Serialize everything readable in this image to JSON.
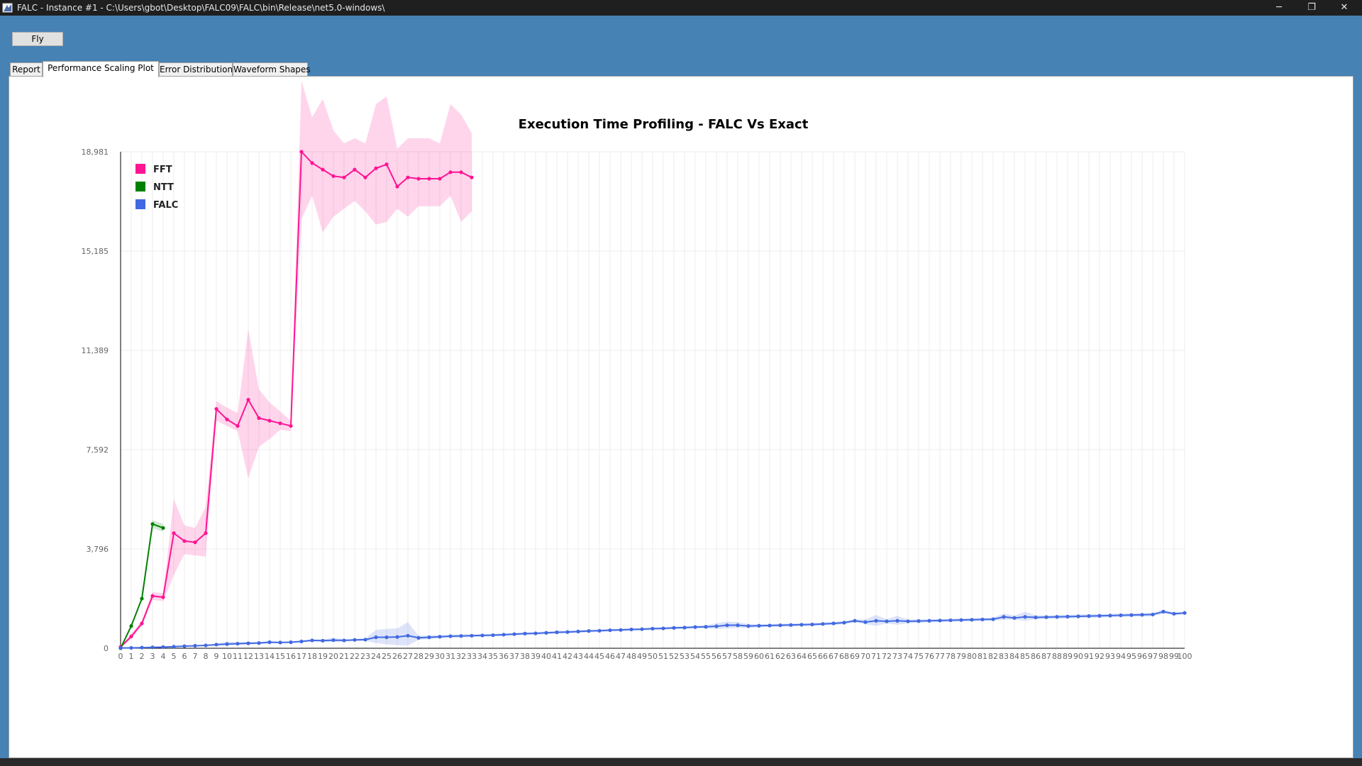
{
  "window": {
    "title": "FALC - Instance #1 - C:\\Users\\gbot\\Desktop\\FALC09\\FALC\\bin\\Release\\net5.0-windows\\",
    "minimize_glyph": "─",
    "maximize_glyph": "❐",
    "close_glyph": "✕"
  },
  "toolbar": {
    "fly_label": "Fly"
  },
  "tabs": [
    {
      "label": "Report",
      "active": false
    },
    {
      "label": "Performance Scaling Plot",
      "active": true
    },
    {
      "label": "Error Distributions",
      "active": false
    },
    {
      "label": "Waveform Shapes",
      "active": false
    }
  ],
  "colors": {
    "fft": "#ff1493",
    "ntt": "#008000",
    "falc": "#4169e1",
    "grid": "#ececec",
    "axis": "#000000",
    "tick_text": "#666666"
  },
  "chart_data": {
    "type": "line",
    "title": "Execution Time Profiling - FALC Vs Exact",
    "xlabel": "",
    "ylabel": "",
    "xlim": [
      0,
      100
    ],
    "ylim": [
      0,
      18981
    ],
    "yticks": [
      0,
      3796,
      7592,
      11389,
      15185,
      18981
    ],
    "ytick_labels": [
      "0",
      "3,796",
      "7,592",
      "11,389",
      "15,185",
      "18,981"
    ],
    "grid": true,
    "legend_position": "top-left",
    "series": [
      {
        "name": "FFT",
        "color": "#ff1493",
        "x": [
          0,
          1,
          2,
          3,
          4,
          5,
          6,
          7,
          8,
          9,
          10,
          11,
          12,
          13,
          14,
          15,
          16,
          17,
          18,
          19,
          20,
          21,
          22,
          23,
          24,
          25,
          26,
          27,
          28,
          29,
          30,
          31,
          32,
          33
        ],
        "y": [
          50,
          450,
          950,
          2000,
          1950,
          4400,
          4100,
          4050,
          4400,
          9150,
          8750,
          8500,
          9500,
          8800,
          8700,
          8600,
          8500,
          18981,
          18550,
          18300,
          18050,
          18000,
          18300,
          18000,
          18350,
          18500,
          17650,
          18000,
          17950,
          17950,
          17950,
          18200,
          18200,
          18000
        ],
        "upper": [
          60,
          560,
          1050,
          2150,
          2100,
          5700,
          4700,
          4600,
          5400,
          9450,
          9200,
          9000,
          12200,
          9900,
          9400,
          9050,
          8700,
          21700,
          20300,
          21000,
          19800,
          19300,
          19500,
          19300,
          20800,
          21100,
          19100,
          19500,
          19500,
          19500,
          19300,
          20800,
          20400,
          19700
        ],
        "lower": [
          40,
          350,
          850,
          1850,
          1800,
          2800,
          3600,
          3550,
          3500,
          8700,
          8500,
          8300,
          6500,
          7700,
          8000,
          8350,
          8300,
          16400,
          17300,
          15900,
          16500,
          16800,
          17100,
          16700,
          16200,
          16300,
          16800,
          16500,
          16900,
          16900,
          16900,
          17300,
          16300,
          16700
        ]
      },
      {
        "name": "NTT",
        "color": "#008000",
        "x": [
          0,
          1,
          2,
          3,
          4
        ],
        "y": [
          0,
          850,
          1900,
          4750,
          4600
        ],
        "upper": [
          0,
          900,
          1950,
          4900,
          4750
        ],
        "lower": [
          0,
          800,
          1850,
          4600,
          4450
        ]
      },
      {
        "name": "FALC",
        "color": "#4169e1",
        "x": [
          0,
          1,
          2,
          3,
          4,
          5,
          6,
          7,
          8,
          9,
          10,
          11,
          12,
          13,
          14,
          15,
          16,
          17,
          18,
          19,
          20,
          21,
          22,
          23,
          24,
          25,
          26,
          27,
          28,
          29,
          30,
          31,
          32,
          33,
          34,
          35,
          36,
          37,
          38,
          39,
          40,
          41,
          42,
          43,
          44,
          45,
          46,
          47,
          48,
          49,
          50,
          51,
          52,
          53,
          54,
          55,
          56,
          57,
          58,
          59,
          60,
          61,
          62,
          63,
          64,
          65,
          66,
          67,
          68,
          69,
          70,
          71,
          72,
          73,
          74,
          75,
          76,
          77,
          78,
          79,
          80,
          81,
          82,
          83,
          84,
          85,
          86,
          87,
          88,
          89,
          90,
          91,
          92,
          93,
          94,
          95,
          96,
          97,
          98,
          99,
          100
        ],
        "y": [
          10,
          15,
          25,
          35,
          45,
          60,
          80,
          95,
          110,
          140,
          160,
          175,
          190,
          200,
          230,
          220,
          230,
          260,
          300,
          290,
          310,
          300,
          320,
          330,
          420,
          420,
          430,
          480,
          400,
          420,
          440,
          460,
          470,
          480,
          490,
          500,
          520,
          540,
          560,
          570,
          590,
          610,
          620,
          640,
          660,
          670,
          690,
          700,
          720,
          730,
          750,
          760,
          780,
          790,
          810,
          820,
          840,
          880,
          880,
          850,
          860,
          870,
          880,
          890,
          900,
          910,
          930,
          950,
          980,
          1050,
          1000,
          1050,
          1030,
          1050,
          1030,
          1040,
          1050,
          1060,
          1070,
          1080,
          1090,
          1100,
          1110,
          1200,
          1160,
          1200,
          1180,
          1190,
          1200,
          1210,
          1220,
          1230,
          1240,
          1250,
          1260,
          1270,
          1280,
          1290,
          1400,
          1320,
          1350
        ],
        "upper": [
          10,
          18,
          30,
          40,
          55,
          75,
          100,
          115,
          135,
          170,
          260,
          230,
          240,
          240,
          270,
          250,
          260,
          300,
          340,
          340,
          400,
          350,
          360,
          380,
          700,
          740,
          760,
          1000,
          480,
          490,
          500,
          520,
          530,
          530,
          540,
          550,
          570,
          590,
          610,
          620,
          640,
          660,
          670,
          690,
          710,
          720,
          740,
          750,
          770,
          780,
          800,
          810,
          830,
          840,
          860,
          880,
          960,
          1020,
          1000,
          930,
          920,
          930,
          940,
          950,
          960,
          970,
          990,
          1010,
          1040,
          1110,
          1100,
          1270,
          1110,
          1240,
          1100,
          1110,
          1110,
          1120,
          1130,
          1140,
          1150,
          1160,
          1170,
          1330,
          1250,
          1400,
          1260,
          1260,
          1270,
          1280,
          1290,
          1300,
          1310,
          1320,
          1330,
          1340,
          1350,
          1360,
          1470,
          1380,
          1400
        ],
        "lower": [
          10,
          12,
          20,
          30,
          35,
          45,
          60,
          75,
          85,
          110,
          100,
          120,
          140,
          160,
          190,
          190,
          200,
          220,
          260,
          240,
          240,
          250,
          280,
          280,
          200,
          150,
          120,
          100,
          320,
          350,
          380,
          400,
          410,
          430,
          440,
          450,
          470,
          490,
          510,
          520,
          540,
          560,
          570,
          590,
          610,
          620,
          640,
          650,
          670,
          680,
          700,
          710,
          730,
          740,
          760,
          760,
          740,
          760,
          780,
          780,
          800,
          810,
          820,
          830,
          840,
          850,
          870,
          890,
          920,
          990,
          920,
          860,
          950,
          900,
          960,
          970,
          990,
          1000,
          1010,
          1020,
          1030,
          1040,
          1050,
          1080,
          1090,
          1050,
          1110,
          1120,
          1130,
          1140,
          1150,
          1160,
          1170,
          1180,
          1190,
          1200,
          1210,
          1220,
          1330,
          1260,
          1300
        ]
      }
    ]
  }
}
